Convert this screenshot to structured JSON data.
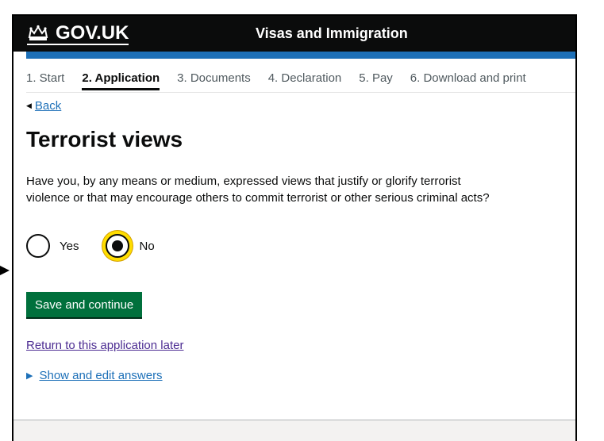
{
  "header": {
    "brand": "GOV.UK",
    "service_name": "Visas and Immigration",
    "crown_icon": "crown-icon",
    "accent_color": "#1d70b8"
  },
  "steps": [
    {
      "label": "1. Start",
      "active": false
    },
    {
      "label": "2. Application",
      "active": true
    },
    {
      "label": "3. Documents",
      "active": false
    },
    {
      "label": "4. Declaration",
      "active": false
    },
    {
      "label": "5. Pay",
      "active": false
    },
    {
      "label": "6. Download and print",
      "active": false
    }
  ],
  "back_link": "Back",
  "page_title": "Terrorist views",
  "question": "Have you, by any means or medium, expressed views that justify or glorify terrorist violence or that may encourage others to commit terrorist or other serious criminal acts?",
  "options": [
    {
      "label": "Yes",
      "selected": false
    },
    {
      "label": "No",
      "selected": true
    }
  ],
  "save_button": "Save and continue",
  "return_link": "Return to this application later",
  "details_link": "Show and edit answers",
  "colors": {
    "button_green": "#00703c",
    "focus_yellow": "#ffdd00",
    "visited_link": "#4c2c92"
  }
}
